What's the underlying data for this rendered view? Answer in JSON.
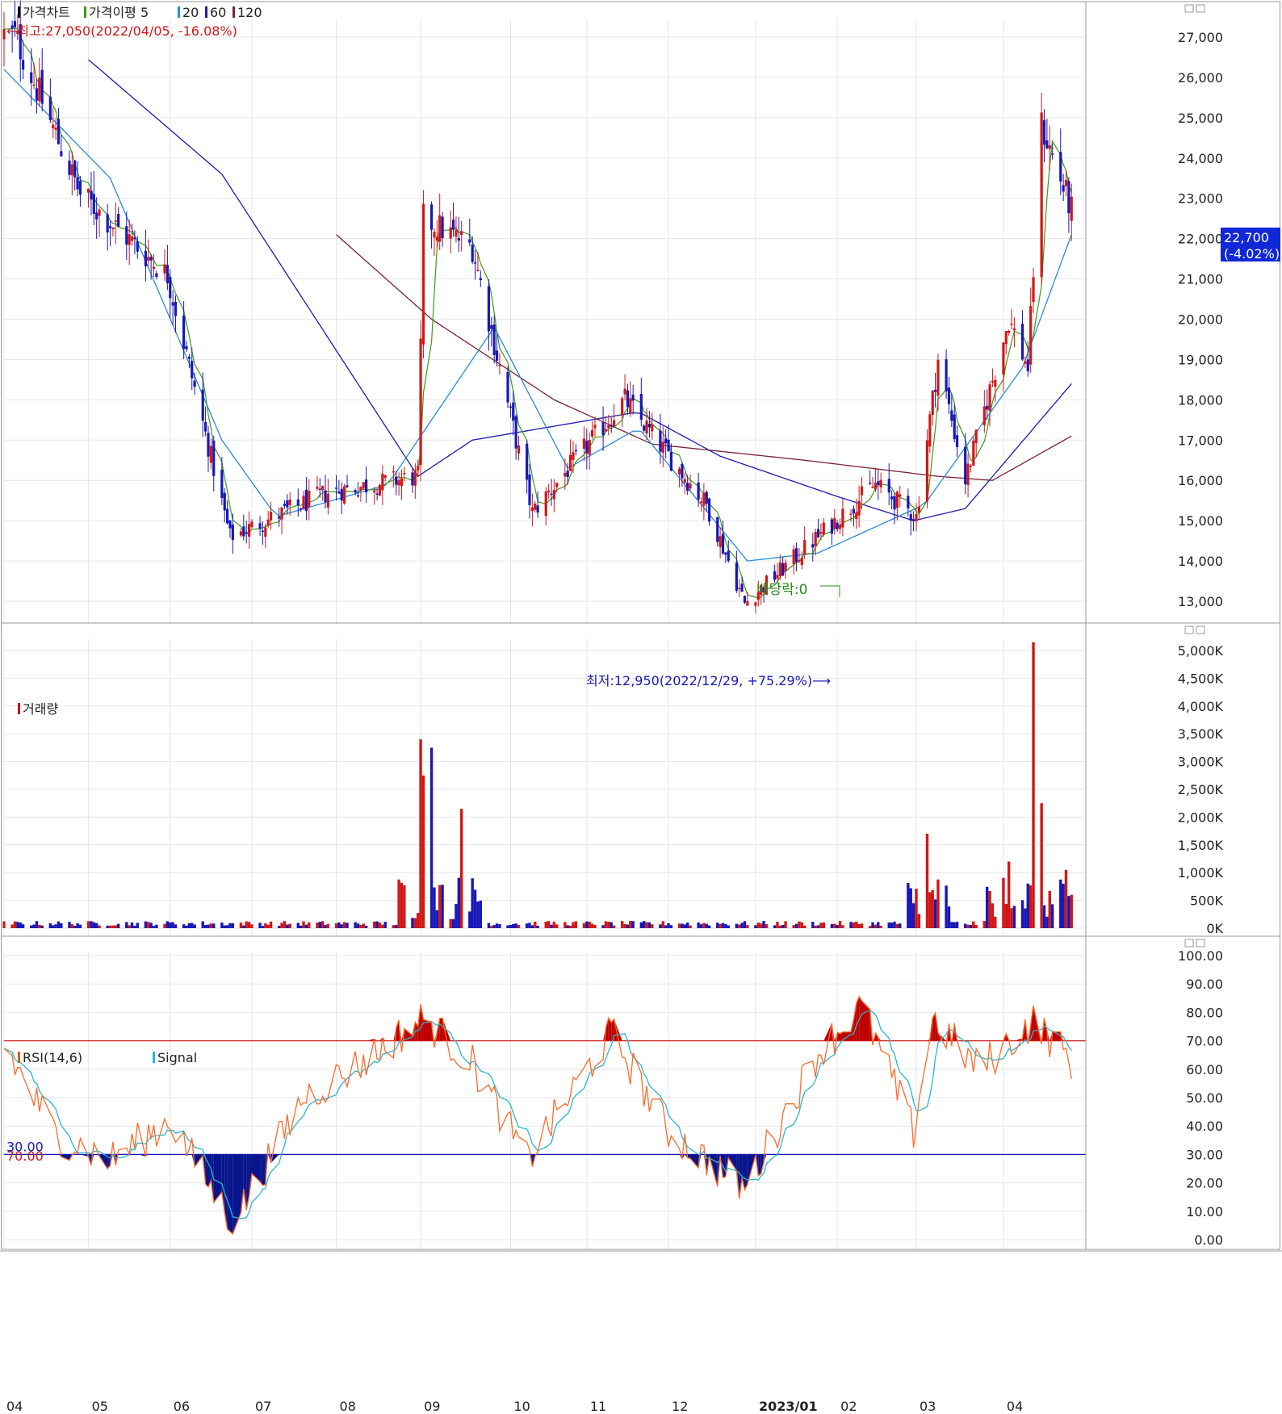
{
  "price_panel": {
    "legend": [
      {
        "text": "가격차트",
        "color": "#000000"
      },
      {
        "text": "가격이평 5",
        "color": "#3c9a18"
      },
      {
        "text": "20",
        "color": "#2a8bd8"
      },
      {
        "text": "60",
        "color": "#1c1cb0"
      },
      {
        "text": "120",
        "color": "#7a2438"
      }
    ],
    "high_annotation": "←최고:27,050(2022/04/05, -16.08%)",
    "low_annotation": "최저:12,950(2022/12/29, +75.29%)⟶",
    "dividend_annotation": "배당락:0",
    "current_price": "22,700",
    "current_change": "(-4.02%)",
    "y_ticks": [
      "27,000",
      "26,000",
      "25,000",
      "24,000",
      "23,000",
      "22,000",
      "21,000",
      "20,000",
      "19,000",
      "18,000",
      "17,000",
      "16,000",
      "15,000",
      "14,000",
      "13,000"
    ]
  },
  "volume_panel": {
    "legend": [
      {
        "text": "거래량",
        "color": "#cc0000"
      }
    ],
    "y_ticks": [
      "5,000K",
      "4,500K",
      "4,000K",
      "3,500K",
      "3,000K",
      "2,500K",
      "2,000K",
      "1,500K",
      "1,000K",
      "500K",
      "0K"
    ]
  },
  "rsi_panel": {
    "legend": [
      {
        "text": "RSI(14,6)",
        "color": "#e85a1a"
      },
      {
        "text": "Signal",
        "color": "#26b8d0"
      }
    ],
    "level_high": "70.00",
    "level_low": "30.00",
    "y_ticks": [
      "100.00",
      "90.00",
      "80.00",
      "70.00",
      "60.00",
      "50.00",
      "40.00",
      "30.00",
      "20.00",
      "10.00",
      "0.00"
    ]
  },
  "x_ticks": [
    "04",
    "05",
    "06",
    "07",
    "08",
    "09",
    "10",
    "11",
    "12",
    "2023/01",
    "02",
    "03",
    "04"
  ],
  "colors": {
    "up": "#d01818",
    "down": "#1818b8",
    "ma5": "#3c9a18",
    "ma20": "#2a8bd8",
    "ma60": "#1c1cb0",
    "ma120": "#7a2438",
    "rsi": "#ff6a2a",
    "signal": "#26b8d0",
    "hi_line": "#d01818",
    "lo_line": "#1818b8"
  },
  "chart_data": {
    "type": "candlestick",
    "period": "2022/04 – 2023/04 (daily)",
    "price_ylim": [
      13000,
      27000
    ],
    "price_key_points": [
      {
        "x": "2022-04-05",
        "close": 27050
      },
      {
        "x": "2022-04-29",
        "close": 23100
      },
      {
        "x": "2022-05-31",
        "close": 21100
      },
      {
        "x": "2022-06-23",
        "close": 14600
      },
      {
        "x": "2022-07-29",
        "close": 15700
      },
      {
        "x": "2022-08-31",
        "close": 16100
      },
      {
        "x": "2022-09-02",
        "close": 22500
      },
      {
        "x": "2022-09-20",
        "close": 21800
      },
      {
        "x": "2022-10-12",
        "close": 15200
      },
      {
        "x": "2022-11-15",
        "close": 18000
      },
      {
        "x": "2022-12-15",
        "close": 15400
      },
      {
        "x": "2022-12-29",
        "close": 12950
      },
      {
        "x": "2023-02-15",
        "close": 15900
      },
      {
        "x": "2023-03-02",
        "close": 15100
      },
      {
        "x": "2023-03-10",
        "close": 19000
      },
      {
        "x": "2023-03-20",
        "close": 16000
      },
      {
        "x": "2023-04-05",
        "close": 20000
      },
      {
        "x": "2023-04-12",
        "close": 18800
      },
      {
        "x": "2023-04-17",
        "close": 24800
      },
      {
        "x": "2023-04-28",
        "close": 22700
      }
    ],
    "ma20_key_points": [
      {
        "x": "2022-04-01",
        "v": 26200
      },
      {
        "x": "2022-05-10",
        "v": 23500
      },
      {
        "x": "2022-06-20",
        "v": 17000
      },
      {
        "x": "2022-07-10",
        "v": 15100
      },
      {
        "x": "2022-08-20",
        "v": 15900
      },
      {
        "x": "2022-09-28",
        "v": 19800
      },
      {
        "x": "2022-10-25",
        "v": 16300
      },
      {
        "x": "2022-11-20",
        "v": 17300
      },
      {
        "x": "2022-12-30",
        "v": 14000
      },
      {
        "x": "2023-01-25",
        "v": 14200
      },
      {
        "x": "2023-03-05",
        "v": 15400
      },
      {
        "x": "2023-04-10",
        "v": 18800
      },
      {
        "x": "2023-04-28",
        "v": 22100
      }
    ],
    "ma60_key_points": [
      {
        "x": "2022-05-01",
        "v": 26500
      },
      {
        "x": "2022-06-20",
        "v": 23600
      },
      {
        "x": "2022-08-31",
        "v": 16100
      },
      {
        "x": "2022-09-20",
        "v": 17000
      },
      {
        "x": "2022-11-20",
        "v": 17700
      },
      {
        "x": "2022-12-20",
        "v": 16600
      },
      {
        "x": "2023-02-01",
        "v": 15600
      },
      {
        "x": "2023-03-01",
        "v": 15000
      },
      {
        "x": "2023-03-20",
        "v": 15300
      },
      {
        "x": "2023-04-28",
        "v": 18400
      }
    ],
    "ma120_key_points": [
      {
        "x": "2022-08-01",
        "v": 22100
      },
      {
        "x": "2022-09-05",
        "v": 20000
      },
      {
        "x": "2022-10-20",
        "v": 18000
      },
      {
        "x": "2022-11-25",
        "v": 16900
      },
      {
        "x": "2023-01-20",
        "v": 16500
      },
      {
        "x": "2023-03-10",
        "v": 16100
      },
      {
        "x": "2023-03-30",
        "v": 16000
      },
      {
        "x": "2023-04-28",
        "v": 17100
      }
    ],
    "volume_ylim": [
      0,
      5200
    ],
    "volume_unit": "K",
    "volume_key_points": [
      {
        "x": "2022-09-01",
        "v": 3400
      },
      {
        "x": "2022-09-02",
        "v": 2750
      },
      {
        "x": "2022-09-05",
        "v": 3250
      },
      {
        "x": "2022-09-16",
        "v": 2150
      },
      {
        "x": "2023-03-06",
        "v": 1700
      },
      {
        "x": "2023-04-05",
        "v": 1200
      },
      {
        "x": "2023-04-14",
        "v": 5150
      },
      {
        "x": "2023-04-17",
        "v": 2250
      },
      {
        "x": "2023-04-26",
        "v": 1050
      }
    ],
    "rsi_ylim": [
      0,
      100
    ],
    "rsi_levels": [
      70,
      30
    ],
    "rsi_key_points": [
      {
        "x": "2022-04-01",
        "v": 68
      },
      {
        "x": "2022-04-20",
        "v": 37
      },
      {
        "x": "2022-05-10",
        "v": 28
      },
      {
        "x": "2022-06-01",
        "v": 42
      },
      {
        "x": "2022-06-24",
        "v": 6
      },
      {
        "x": "2022-07-20",
        "v": 50
      },
      {
        "x": "2022-08-10",
        "v": 62
      },
      {
        "x": "2022-09-02",
        "v": 78
      },
      {
        "x": "2022-09-20",
        "v": 62
      },
      {
        "x": "2022-10-10",
        "v": 28
      },
      {
        "x": "2022-11-10",
        "v": 73
      },
      {
        "x": "2022-12-01",
        "v": 38
      },
      {
        "x": "2022-12-29",
        "v": 18
      },
      {
        "x": "2023-01-25",
        "v": 66
      },
      {
        "x": "2023-02-10",
        "v": 82
      },
      {
        "x": "2023-03-01",
        "v": 38
      },
      {
        "x": "2023-03-08",
        "v": 78
      },
      {
        "x": "2023-03-25",
        "v": 60
      },
      {
        "x": "2023-04-14",
        "v": 77
      },
      {
        "x": "2023-04-28",
        "v": 63
      }
    ]
  }
}
